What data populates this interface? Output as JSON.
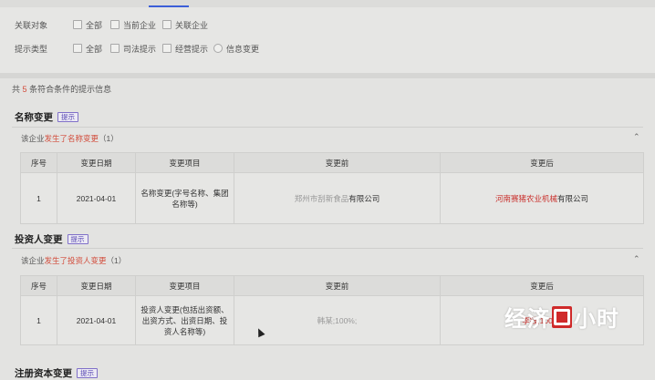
{
  "filters": {
    "related": {
      "label": "关联对象",
      "options": [
        "全部",
        "当前企业",
        "关联企业"
      ]
    },
    "hint_type": {
      "label": "提示类型",
      "options": [
        "全部",
        "司法提示",
        "经营提示",
        "信息变更"
      ]
    }
  },
  "summary": {
    "prefix": "共",
    "count": "5",
    "suffix": "条符合条件的提示信息"
  },
  "sections": [
    {
      "title": "名称变更",
      "tag": "提示",
      "sub_prefix": "该企业",
      "sub_highlight": "发生了名称变更",
      "sub_count": "（1）",
      "columns": [
        "序号",
        "变更日期",
        "变更项目",
        "变更前",
        "变更后"
      ],
      "row": {
        "index": "1",
        "date": "2021-04-01",
        "item": "名称变更(字号名称、集团名称等)",
        "before_faded": "郑州市刮新食品",
        "before_rest": "有限公司",
        "after_red": "河南赛猪农业机械",
        "after_rest": "有限公司"
      }
    },
    {
      "title": "投资人变更",
      "tag": "提示",
      "sub_prefix": "该企业",
      "sub_highlight": "发生了投资人变更",
      "sub_count": "（1）",
      "columns": [
        "序号",
        "变更日期",
        "变更项目",
        "变更前",
        "变更后"
      ],
      "row": {
        "index": "1",
        "date": "2021-04-01",
        "item": "投资人变更(包括出资额、出资方式、出资日期、投资人名称等)",
        "before_faded": "韩某;100%;",
        "after_red": "李钱;100%;"
      }
    },
    {
      "title": "注册资本变更",
      "tag": "提示"
    }
  ],
  "watermark": {
    "text_a": "经济",
    "text_b": "小时"
  },
  "colors": {
    "accent": "#3d5fd8",
    "highlight": "#d24b3a",
    "tag": "#5b4bb5",
    "logo_red": "#cf2a2a"
  }
}
